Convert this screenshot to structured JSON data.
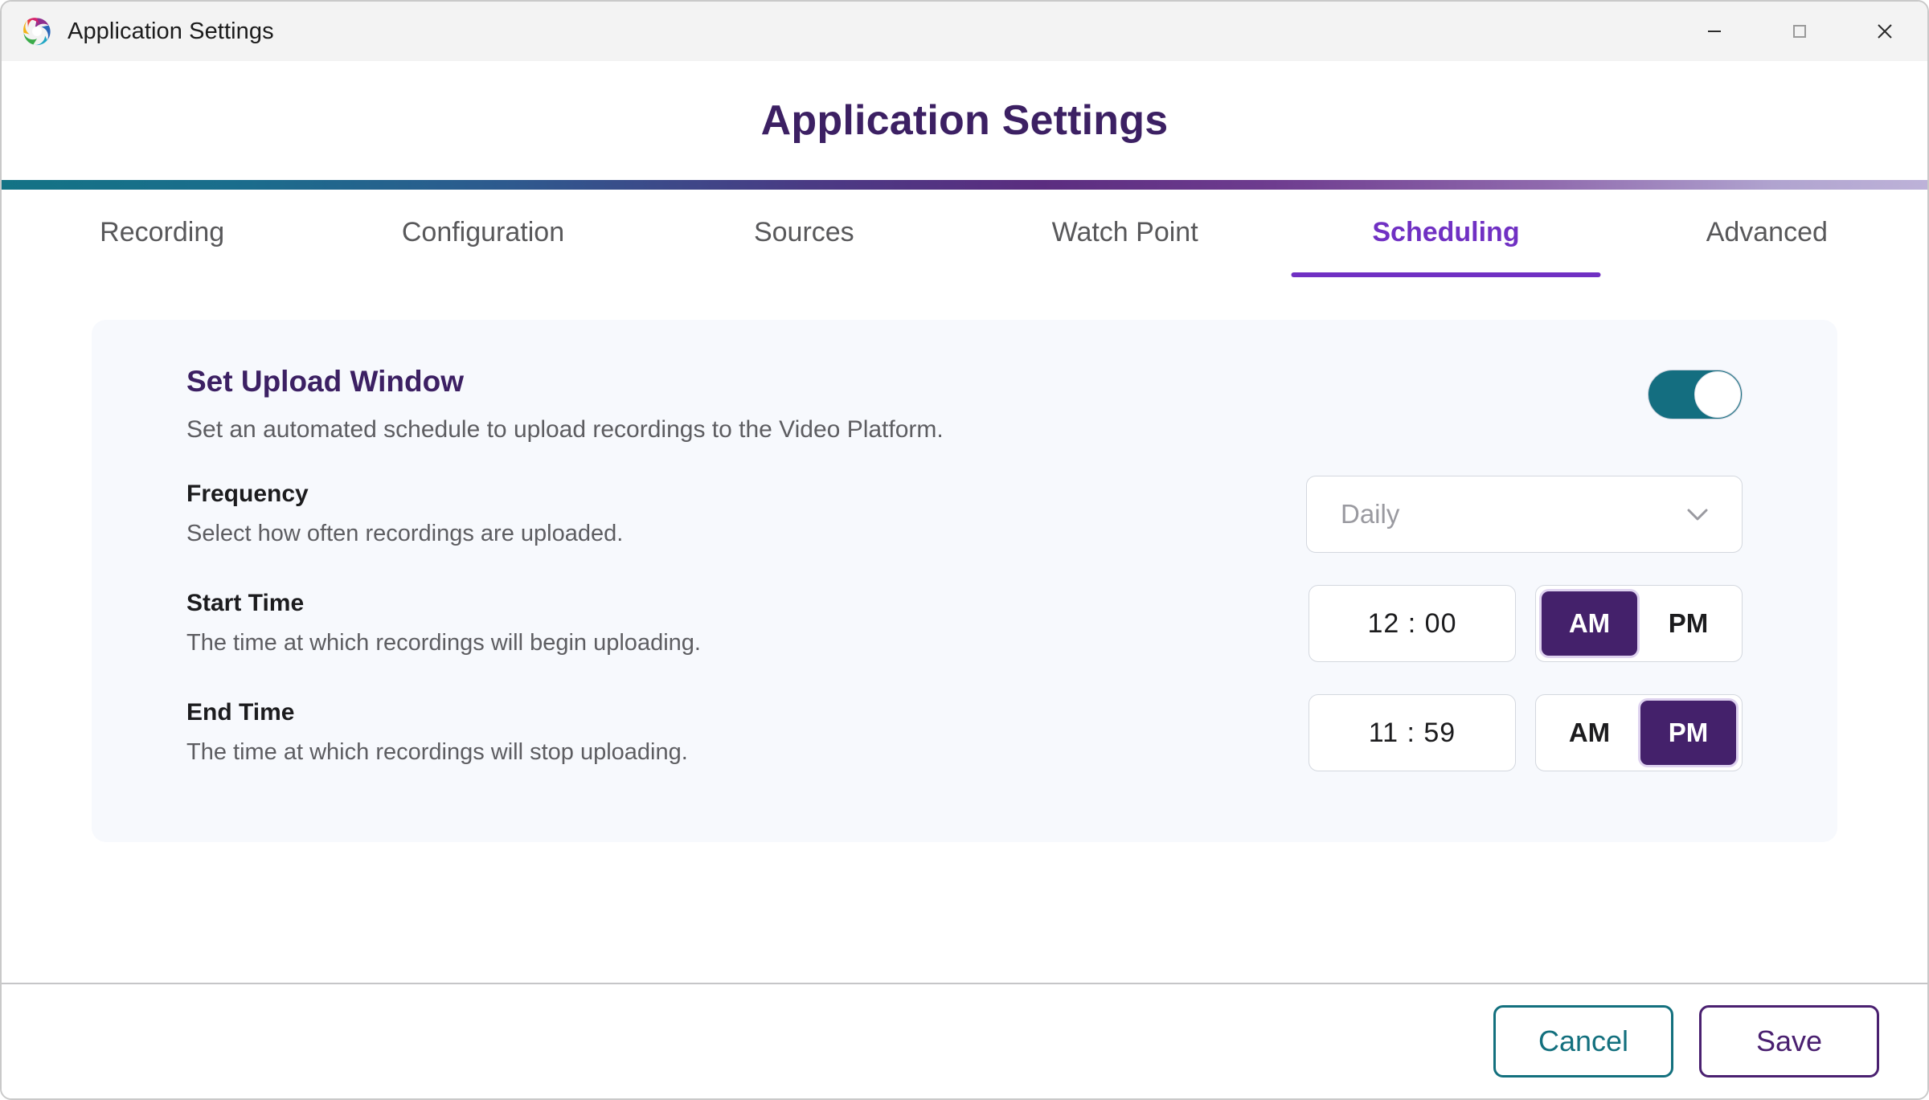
{
  "window": {
    "titlebar": {
      "logo_icon": "swirl-logo-icon",
      "title": "Application Settings",
      "minimize_icon": "minimize-icon",
      "maximize_icon": "maximize-icon",
      "close_icon": "close-icon"
    },
    "accent_colors": {
      "purple": "#7030c3",
      "dark_purple": "#3c2063",
      "teal": "#13707e",
      "toggle_on": "#146e80",
      "gradient_start": "#137385",
      "gradient_mid": "#5b2d80",
      "gradient_end": "#bdb2d8"
    }
  },
  "header": {
    "title": "Application Settings"
  },
  "tabs": [
    {
      "label": "Recording",
      "active": false
    },
    {
      "label": "Configuration",
      "active": false
    },
    {
      "label": "Sources",
      "active": false
    },
    {
      "label": "Watch Point",
      "active": false
    },
    {
      "label": "Scheduling",
      "active": true
    },
    {
      "label": "Advanced",
      "active": false
    }
  ],
  "card": {
    "title": "Set Upload Window",
    "description": "Set an automated schedule to upload recordings to the Video Platform.",
    "toggle": {
      "name": "set-upload-window-toggle",
      "state": "on"
    },
    "rows": [
      {
        "label": "Frequency",
        "description": "Select how often recordings are uploaded.",
        "control": "select",
        "value": "Daily",
        "chevron_icon": "chevron-down-icon"
      },
      {
        "label": "Start Time",
        "description": "The time at which recordings will begin uploading.",
        "control": "time",
        "time": "12 : 00",
        "meridiem": {
          "am": "AM",
          "pm": "PM",
          "selected": "AM"
        }
      },
      {
        "label": "End Time",
        "description": "The time at which recordings will stop uploading.",
        "control": "time",
        "time": "11 : 59",
        "meridiem": {
          "am": "AM",
          "pm": "PM",
          "selected": "PM"
        }
      }
    ]
  },
  "footer": {
    "cancel_label": "Cancel",
    "save_label": "Save"
  }
}
